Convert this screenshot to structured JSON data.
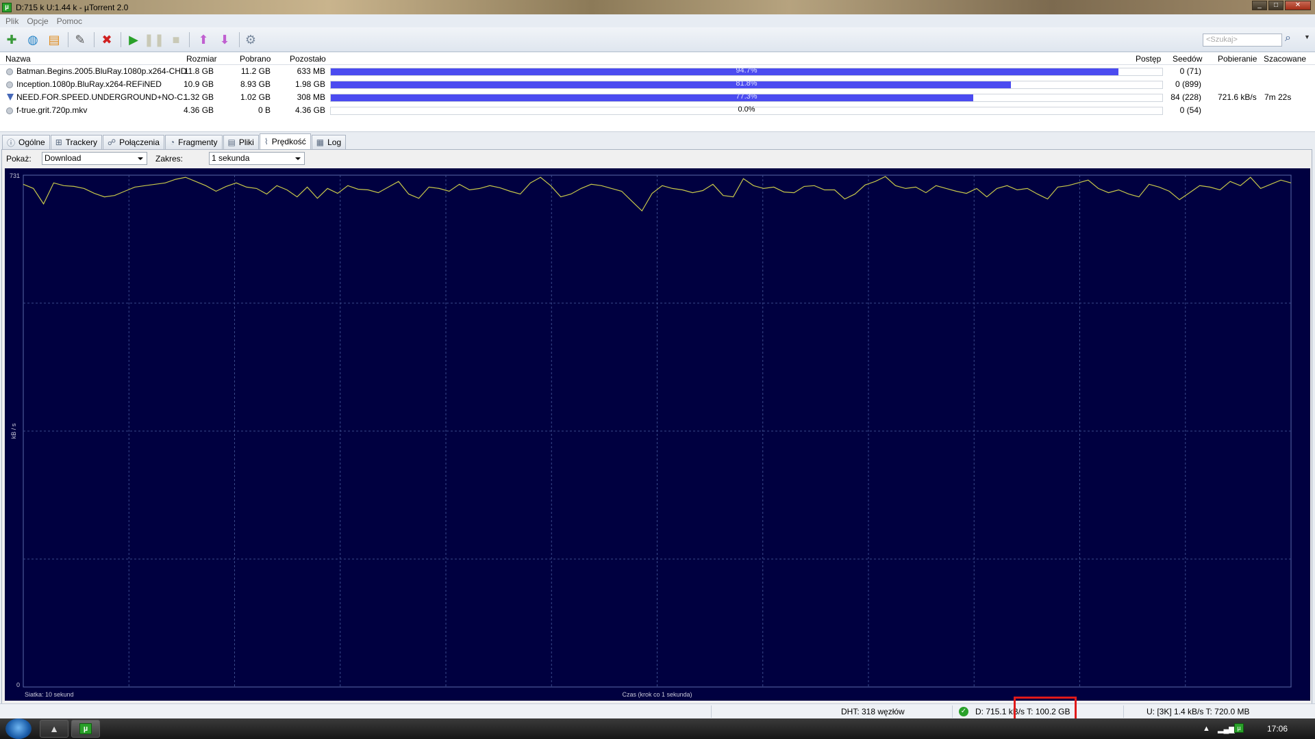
{
  "window": {
    "title": "D:715 k U:1.44 k - µTorrent 2.0"
  },
  "menu": [
    "Plik",
    "Opcje",
    "Pomoc"
  ],
  "toolbar": {
    "search_placeholder": "<Szukaj>"
  },
  "columns": {
    "name": "Nazwa",
    "size": "Rozmiar",
    "downloaded": "Pobrano",
    "remaining": "Pozostało",
    "progress": "Postęp",
    "seeds": "Seedów",
    "down_speed": "Pobieranie",
    "eta": "Szacowane"
  },
  "torrents": [
    {
      "name": "Batman.Begins.2005.BluRay.1080p.x264-CHD",
      "size": "11.8 GB",
      "downloaded": "11.2 GB",
      "remaining": "633 MB",
      "progress_label": "94.7%",
      "progress": 0.947,
      "seeds": "0 (71)",
      "down_speed": "",
      "eta": "",
      "status": "queued"
    },
    {
      "name": "Inception.1080p.BluRay.x264-REFiNED",
      "size": "10.9 GB",
      "downloaded": "8.93 GB",
      "remaining": "1.98 GB",
      "progress_label": "81.8%",
      "progress": 0.818,
      "seeds": "0 (899)",
      "down_speed": "",
      "eta": "",
      "status": "queued"
    },
    {
      "name": "NEED.FOR.SPEED.UNDERGROUND+NO-C...",
      "size": "1.32 GB",
      "downloaded": "1.02 GB",
      "remaining": "308 MB",
      "progress_label": "77.3%",
      "progress": 0.773,
      "seeds": "84 (228)",
      "down_speed": "721.6 kB/s",
      "eta": "7m 22s",
      "status": "downloading"
    },
    {
      "name": "f-true.grit.720p.mkv",
      "size": "4.36 GB",
      "downloaded": "0 B",
      "remaining": "4.36 GB",
      "progress_label": "0.0%",
      "progress": 0.0,
      "seeds": "0 (54)",
      "down_speed": "",
      "eta": "",
      "status": "queued"
    }
  ],
  "tabs": [
    {
      "label": "Ogólne",
      "icon": "info-icon"
    },
    {
      "label": "Trackery",
      "icon": "network-icon"
    },
    {
      "label": "Połączenia",
      "icon": "peers-icon"
    },
    {
      "label": "Fragmenty",
      "icon": "pieces-icon"
    },
    {
      "label": "Pliki",
      "icon": "files-icon"
    },
    {
      "label": "Prędkość",
      "icon": "speed-icon",
      "active": true
    },
    {
      "label": "Log",
      "icon": "log-icon"
    }
  ],
  "speed_panel": {
    "show_label": "Pokaż:",
    "show_value": "Download",
    "range_label": "Zakres:",
    "range_value": "1 sekunda"
  },
  "chart_data": {
    "type": "line",
    "ylabel": "kB / s",
    "xlabel": "Czas (krok co 1 sekunda)",
    "grid_label": "Siatka: 10 sekund",
    "ylim": [
      0,
      731
    ],
    "y_ticks": [
      "731",
      "0"
    ],
    "line_color": "#c8c84a",
    "background": "#000040",
    "x_points": 120,
    "y": [
      718,
      712,
      690,
      720,
      716,
      715,
      712,
      705,
      700,
      702,
      708,
      714,
      716,
      718,
      720,
      725,
      728,
      722,
      716,
      708,
      715,
      720,
      714,
      712,
      704,
      716,
      710,
      700,
      714,
      698,
      712,
      705,
      716,
      711,
      710,
      706,
      714,
      722,
      704,
      698,
      714,
      712,
      708,
      718,
      710,
      712,
      716,
      713,
      708,
      704,
      720,
      728,
      716,
      700,
      704,
      712,
      718,
      716,
      712,
      708,
      694,
      680,
      705,
      716,
      712,
      710,
      706,
      709,
      718,
      702,
      700,
      726,
      716,
      712,
      714,
      707,
      706,
      715,
      716,
      710,
      710,
      697,
      704,
      717,
      722,
      729,
      716,
      712,
      714,
      706,
      716,
      712,
      708,
      705,
      712,
      700,
      712,
      716,
      710,
      712,
      704,
      697,
      714,
      716,
      720,
      724,
      712,
      706,
      710,
      704,
      700,
      718,
      714,
      708,
      696,
      706,
      716,
      714,
      710,
      722,
      716,
      728,
      712,
      718,
      724,
      720
    ]
  },
  "statusbar": {
    "dht": "DHT: 318 węzłów",
    "download": "D: 715.1 kB/s T: 100.2 GB",
    "upload": "U:  [3K] 1.4 kB/s T: 720.0 MB"
  },
  "taskbar": {
    "clock": "17:06"
  }
}
